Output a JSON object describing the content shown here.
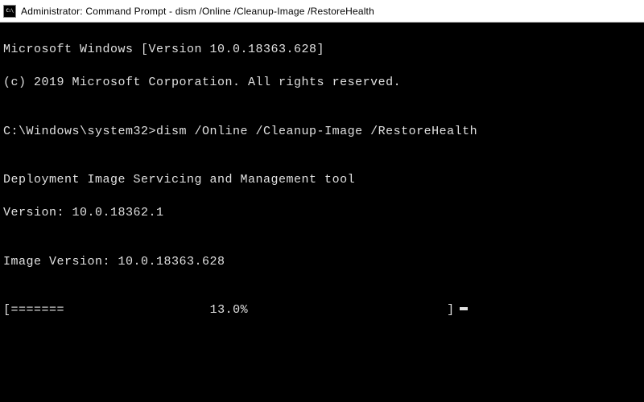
{
  "titlebar": {
    "text": "Administrator: Command Prompt - dism  /Online /Cleanup-Image /RestoreHealth"
  },
  "terminal": {
    "line1": "Microsoft Windows [Version 10.0.18363.628]",
    "line2": "(c) 2019 Microsoft Corporation. All rights reserved.",
    "blank1": "",
    "prompt": "C:\\Windows\\system32>",
    "command": "dism /Online /Cleanup-Image /RestoreHealth",
    "blank2": "",
    "tool_name": "Deployment Image Servicing and Management tool",
    "tool_version": "Version: 10.0.18362.1",
    "blank3": "",
    "image_version": "Image Version: 10.0.18363.628",
    "blank4": "",
    "progress": {
      "open": "[",
      "filled": "=======",
      "gap1": "                   ",
      "percent": "13.0%",
      "gap2": "                          ",
      "close": "]"
    }
  }
}
